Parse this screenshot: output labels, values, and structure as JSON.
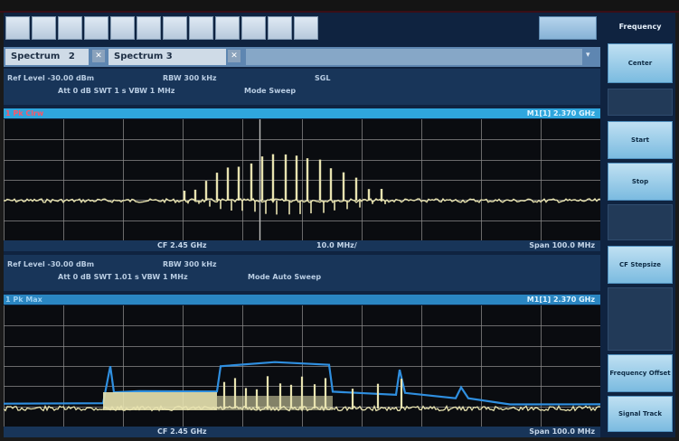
{
  "tabs": {
    "tab1_label": "Spectrum",
    "tab1_badge": "2",
    "tab2_label": "Spectrum 3"
  },
  "softkeys": {
    "header": "Frequency",
    "keys": [
      "Center",
      "Start",
      "Stop",
      "CF Stepsize",
      "Frequency Offset",
      "Signal Track"
    ]
  },
  "window1": {
    "info_ref_level": "Ref Level -30.00 dBm",
    "info_rbw": "RBW 300 kHz",
    "info_att_line": "Att 0 dB  SWT 1 s  VBW 1 MHz",
    "info_mode": "Mode Sweep",
    "info_sgl": "SGL",
    "trace_label": "1 Pk Clrw",
    "marker_readout": "M1[1]  2.370 GHz",
    "center_freq": "CF 2.45 GHz",
    "span_per_div": "10.0 MHz/",
    "span": "Span 100.0 MHz"
  },
  "window2": {
    "info_ref_level": "Ref Level -30.00 dBm",
    "info_rbw": "RBW 300 kHz",
    "info_att_line": "Att 0 dB  SWT 1.01 s  VBW 1 MHz",
    "info_mode": "Mode Auto Sweep",
    "trace_label": "1 Pk Max",
    "marker_readout": "M1[1]  2.370 GHz",
    "center_freq": "CF 2.45 GHz",
    "span": "Span 100.0 MHz"
  },
  "colors": {
    "trace_yellow": "#e8e3b0",
    "trace_blue": "#2f8fe0",
    "grid": "#8a8a8a",
    "title_bar": "#2fa6dd"
  }
}
